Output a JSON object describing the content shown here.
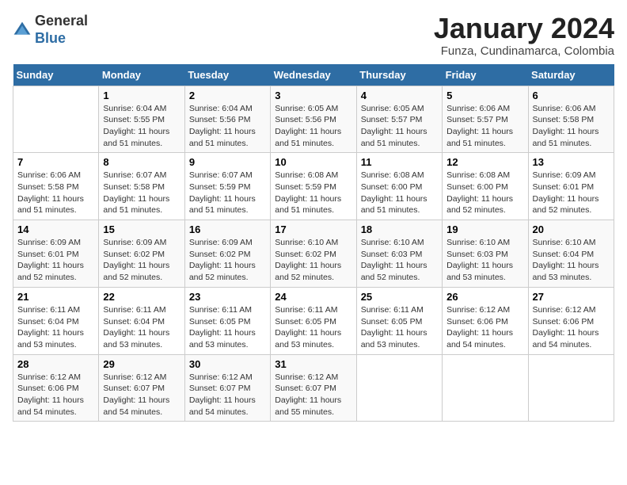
{
  "header": {
    "logo_general": "General",
    "logo_blue": "Blue",
    "month_title": "January 2024",
    "location": "Funza, Cundinamarca, Colombia"
  },
  "weekdays": [
    "Sunday",
    "Monday",
    "Tuesday",
    "Wednesday",
    "Thursday",
    "Friday",
    "Saturday"
  ],
  "weeks": [
    [
      {
        "day": "",
        "sunrise": "",
        "sunset": "",
        "daylight": ""
      },
      {
        "day": "1",
        "sunrise": "Sunrise: 6:04 AM",
        "sunset": "Sunset: 5:55 PM",
        "daylight": "Daylight: 11 hours and 51 minutes."
      },
      {
        "day": "2",
        "sunrise": "Sunrise: 6:04 AM",
        "sunset": "Sunset: 5:56 PM",
        "daylight": "Daylight: 11 hours and 51 minutes."
      },
      {
        "day": "3",
        "sunrise": "Sunrise: 6:05 AM",
        "sunset": "Sunset: 5:56 PM",
        "daylight": "Daylight: 11 hours and 51 minutes."
      },
      {
        "day": "4",
        "sunrise": "Sunrise: 6:05 AM",
        "sunset": "Sunset: 5:57 PM",
        "daylight": "Daylight: 11 hours and 51 minutes."
      },
      {
        "day": "5",
        "sunrise": "Sunrise: 6:06 AM",
        "sunset": "Sunset: 5:57 PM",
        "daylight": "Daylight: 11 hours and 51 minutes."
      },
      {
        "day": "6",
        "sunrise": "Sunrise: 6:06 AM",
        "sunset": "Sunset: 5:58 PM",
        "daylight": "Daylight: 11 hours and 51 minutes."
      }
    ],
    [
      {
        "day": "7",
        "sunrise": "Sunrise: 6:06 AM",
        "sunset": "Sunset: 5:58 PM",
        "daylight": "Daylight: 11 hours and 51 minutes."
      },
      {
        "day": "8",
        "sunrise": "Sunrise: 6:07 AM",
        "sunset": "Sunset: 5:58 PM",
        "daylight": "Daylight: 11 hours and 51 minutes."
      },
      {
        "day": "9",
        "sunrise": "Sunrise: 6:07 AM",
        "sunset": "Sunset: 5:59 PM",
        "daylight": "Daylight: 11 hours and 51 minutes."
      },
      {
        "day": "10",
        "sunrise": "Sunrise: 6:08 AM",
        "sunset": "Sunset: 5:59 PM",
        "daylight": "Daylight: 11 hours and 51 minutes."
      },
      {
        "day": "11",
        "sunrise": "Sunrise: 6:08 AM",
        "sunset": "Sunset: 6:00 PM",
        "daylight": "Daylight: 11 hours and 51 minutes."
      },
      {
        "day": "12",
        "sunrise": "Sunrise: 6:08 AM",
        "sunset": "Sunset: 6:00 PM",
        "daylight": "Daylight: 11 hours and 52 minutes."
      },
      {
        "day": "13",
        "sunrise": "Sunrise: 6:09 AM",
        "sunset": "Sunset: 6:01 PM",
        "daylight": "Daylight: 11 hours and 52 minutes."
      }
    ],
    [
      {
        "day": "14",
        "sunrise": "Sunrise: 6:09 AM",
        "sunset": "Sunset: 6:01 PM",
        "daylight": "Daylight: 11 hours and 52 minutes."
      },
      {
        "day": "15",
        "sunrise": "Sunrise: 6:09 AM",
        "sunset": "Sunset: 6:02 PM",
        "daylight": "Daylight: 11 hours and 52 minutes."
      },
      {
        "day": "16",
        "sunrise": "Sunrise: 6:09 AM",
        "sunset": "Sunset: 6:02 PM",
        "daylight": "Daylight: 11 hours and 52 minutes."
      },
      {
        "day": "17",
        "sunrise": "Sunrise: 6:10 AM",
        "sunset": "Sunset: 6:02 PM",
        "daylight": "Daylight: 11 hours and 52 minutes."
      },
      {
        "day": "18",
        "sunrise": "Sunrise: 6:10 AM",
        "sunset": "Sunset: 6:03 PM",
        "daylight": "Daylight: 11 hours and 52 minutes."
      },
      {
        "day": "19",
        "sunrise": "Sunrise: 6:10 AM",
        "sunset": "Sunset: 6:03 PM",
        "daylight": "Daylight: 11 hours and 53 minutes."
      },
      {
        "day": "20",
        "sunrise": "Sunrise: 6:10 AM",
        "sunset": "Sunset: 6:04 PM",
        "daylight": "Daylight: 11 hours and 53 minutes."
      }
    ],
    [
      {
        "day": "21",
        "sunrise": "Sunrise: 6:11 AM",
        "sunset": "Sunset: 6:04 PM",
        "daylight": "Daylight: 11 hours and 53 minutes."
      },
      {
        "day": "22",
        "sunrise": "Sunrise: 6:11 AM",
        "sunset": "Sunset: 6:04 PM",
        "daylight": "Daylight: 11 hours and 53 minutes."
      },
      {
        "day": "23",
        "sunrise": "Sunrise: 6:11 AM",
        "sunset": "Sunset: 6:05 PM",
        "daylight": "Daylight: 11 hours and 53 minutes."
      },
      {
        "day": "24",
        "sunrise": "Sunrise: 6:11 AM",
        "sunset": "Sunset: 6:05 PM",
        "daylight": "Daylight: 11 hours and 53 minutes."
      },
      {
        "day": "25",
        "sunrise": "Sunrise: 6:11 AM",
        "sunset": "Sunset: 6:05 PM",
        "daylight": "Daylight: 11 hours and 53 minutes."
      },
      {
        "day": "26",
        "sunrise": "Sunrise: 6:12 AM",
        "sunset": "Sunset: 6:06 PM",
        "daylight": "Daylight: 11 hours and 54 minutes."
      },
      {
        "day": "27",
        "sunrise": "Sunrise: 6:12 AM",
        "sunset": "Sunset: 6:06 PM",
        "daylight": "Daylight: 11 hours and 54 minutes."
      }
    ],
    [
      {
        "day": "28",
        "sunrise": "Sunrise: 6:12 AM",
        "sunset": "Sunset: 6:06 PM",
        "daylight": "Daylight: 11 hours and 54 minutes."
      },
      {
        "day": "29",
        "sunrise": "Sunrise: 6:12 AM",
        "sunset": "Sunset: 6:07 PM",
        "daylight": "Daylight: 11 hours and 54 minutes."
      },
      {
        "day": "30",
        "sunrise": "Sunrise: 6:12 AM",
        "sunset": "Sunset: 6:07 PM",
        "daylight": "Daylight: 11 hours and 54 minutes."
      },
      {
        "day": "31",
        "sunrise": "Sunrise: 6:12 AM",
        "sunset": "Sunset: 6:07 PM",
        "daylight": "Daylight: 11 hours and 55 minutes."
      },
      {
        "day": "",
        "sunrise": "",
        "sunset": "",
        "daylight": ""
      },
      {
        "day": "",
        "sunrise": "",
        "sunset": "",
        "daylight": ""
      },
      {
        "day": "",
        "sunrise": "",
        "sunset": "",
        "daylight": ""
      }
    ]
  ]
}
